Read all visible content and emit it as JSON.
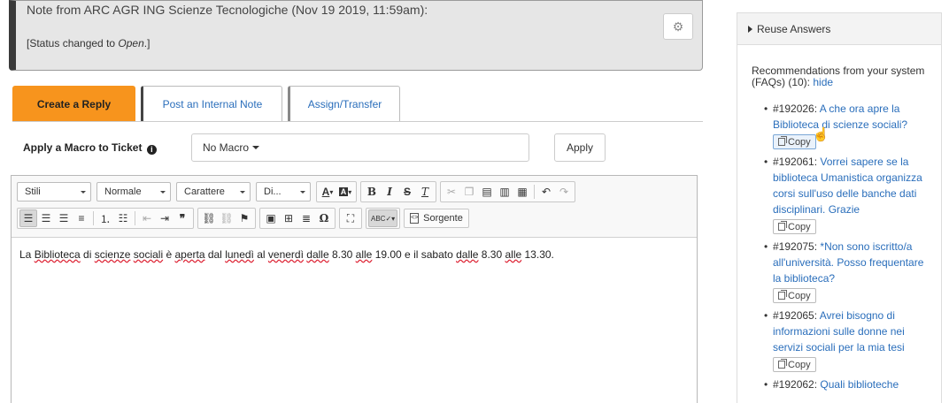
{
  "note": {
    "title": "Note from ARC AGR ING Scienze Tecnologiche (Nov 19 2019, 11:59am):",
    "status_prefix": "[Status changed to ",
    "status_value": "Open",
    "status_suffix": ".]",
    "settings_icon": "gear-icon"
  },
  "tabs": [
    {
      "label": "Create a Reply",
      "active": true
    },
    {
      "label": "Post an Internal Note",
      "active": false
    },
    {
      "label": "Assign/Transfer",
      "active": false
    }
  ],
  "macro": {
    "label": "Apply a Macro to Ticket",
    "selected": "No Macro",
    "apply_label": "Apply"
  },
  "editor": {
    "combos": {
      "styles": "Stili",
      "format": "Normale",
      "font": "Carattere",
      "size": "Di..."
    },
    "source_label": "Sorgente",
    "content": {
      "w1": "La ",
      "s1": "Biblioteca",
      "w2": " di ",
      "s2": "scienze",
      "w3": " ",
      "s3": "sociali",
      "w4": " è ",
      "s4": "aperta",
      "w5": " dal ",
      "s5": "lunedì",
      "w6": " al ",
      "s6": "venerdì",
      "w7": " ",
      "s7": "dalle",
      "w8": " 8.30 ",
      "s8": "alle",
      "w9": " 19.00 e il sabato ",
      "s9": "dalle",
      "w10": " 8.30 ",
      "s10": "alle",
      "w11": " 13.30."
    }
  },
  "sidebar": {
    "header": "Reuse Answers",
    "recommend_text": "Recommendations from your system (FAQs) (10):",
    "hide_label": "hide",
    "copy_label": "Copy",
    "faqs": [
      {
        "id": "#192026:",
        "title": "A che ora apre la Biblioteca di scienze sociali?"
      },
      {
        "id": "#192061:",
        "title": "Vorrei sapere se la biblioteca Umanistica organizza corsi sull'uso delle banche dati disciplinari. Grazie"
      },
      {
        "id": "#192075:",
        "title": "*Non sono iscritto/a all'università. Posso frequentare la biblioteca?"
      },
      {
        "id": "#192065:",
        "title": "Avrei bisogno di informazioni sulle donne nei servizi sociali per la mia tesi"
      },
      {
        "id": "#192062:",
        "title": "Quali biblioteche"
      }
    ]
  },
  "colors": {
    "accent": "#f7941d",
    "link": "#2a6ebb"
  }
}
